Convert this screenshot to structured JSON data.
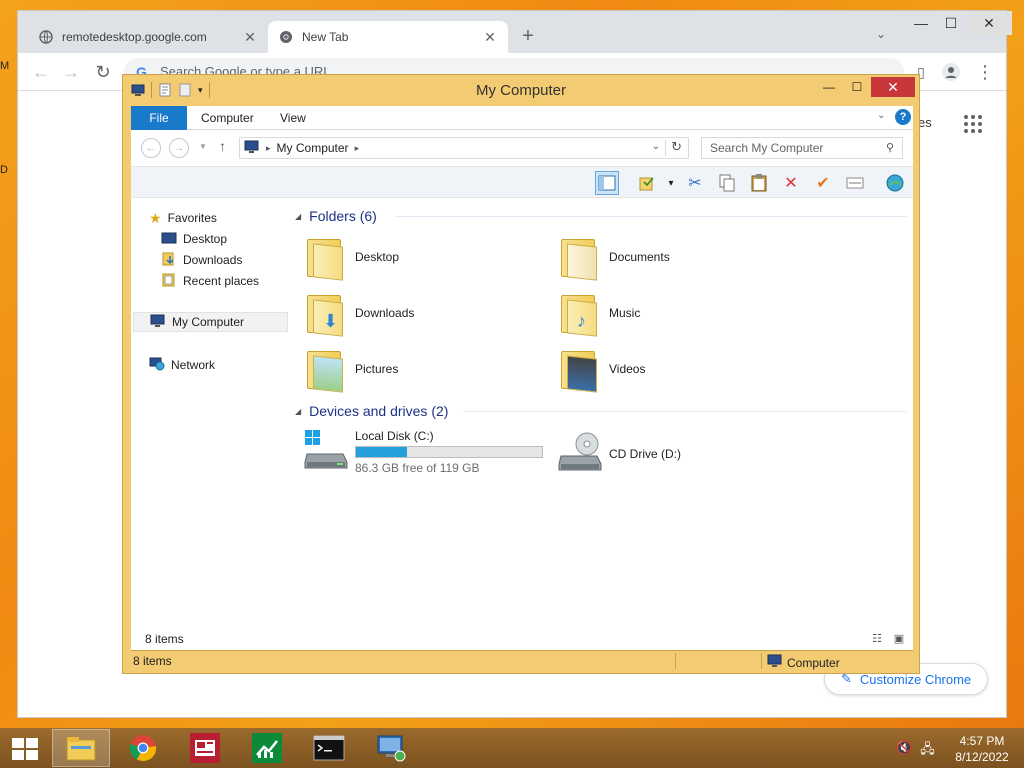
{
  "desktop": {
    "edge_chars": [
      "M",
      "D"
    ]
  },
  "chrome": {
    "tabs": [
      {
        "title": "remotedesktop.google.com",
        "active": false
      },
      {
        "title": "New Tab",
        "active": true
      }
    ],
    "new_tab": "+",
    "omnibox_placeholder": "Search Google or type a URL",
    "ntp_right_label": "es",
    "customize_label": "Customize Chrome"
  },
  "explorer": {
    "title": "My Computer",
    "ribbon_tabs": [
      "File",
      "Computer",
      "View"
    ],
    "help": "?",
    "address": "My Computer",
    "search_placeholder": "Search My Computer",
    "nav": {
      "favorites": "Favorites",
      "fav_items": [
        "Desktop",
        "Downloads",
        "Recent places"
      ],
      "computer": "My Computer",
      "network": "Network"
    },
    "folders_heading": "Folders (6)",
    "folders": [
      "Desktop",
      "Documents",
      "Downloads",
      "Music",
      "Pictures",
      "Videos"
    ],
    "devices_heading": "Devices and drives (2)",
    "drives": [
      {
        "name": "Local Disk (C:)",
        "free": "86.3 GB free of 119 GB",
        "used_fraction": 0.275
      },
      {
        "name": "CD Drive (D:)"
      }
    ],
    "inner_status_count": "8 items",
    "outer_status_count": "8 items",
    "outer_status_zone": "Computer"
  },
  "taskbar": {
    "time": "4:57 PM",
    "date": "8/12/2022"
  },
  "colors": {
    "accent_blue": "#1979ca",
    "drive_fill": "#26a0da",
    "frame_gold": "#f2cb72",
    "close_red": "#c7373a"
  }
}
